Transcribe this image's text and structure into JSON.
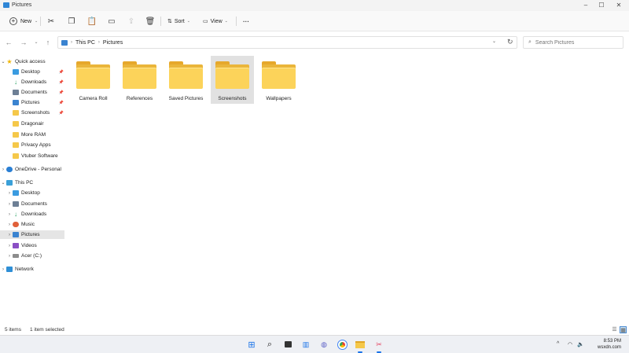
{
  "window": {
    "title": "Pictures",
    "controls": [
      "minimize-icon",
      "maximize-icon",
      "close-icon"
    ]
  },
  "toolbar": {
    "new_label": "New",
    "sort_label": "Sort",
    "view_label": "View",
    "more_label": "···",
    "icons": [
      "cut-icon",
      "copy-icon",
      "paste-icon",
      "rename-icon",
      "share-icon",
      "delete-icon"
    ]
  },
  "address": {
    "crumbs": [
      "This PC",
      "Pictures"
    ],
    "search_placeholder": "Search Pictures"
  },
  "sidebar": {
    "quick_access": {
      "label": "Quick access",
      "items": [
        {
          "label": "Desktop",
          "icon": "desktop-icon",
          "pinned": true
        },
        {
          "label": "Downloads",
          "icon": "downloads-icon",
          "pinned": true
        },
        {
          "label": "Documents",
          "icon": "documents-icon",
          "pinned": true
        },
        {
          "label": "Pictures",
          "icon": "pictures-icon",
          "pinned": true
        },
        {
          "label": "Screenshots",
          "icon": "folder-icon",
          "pinned": true
        },
        {
          "label": "Dragonair",
          "icon": "folder-icon",
          "pinned": false
        },
        {
          "label": "More RAM",
          "icon": "folder-icon",
          "pinned": false
        },
        {
          "label": "Privacy Apps",
          "icon": "folder-icon",
          "pinned": false
        },
        {
          "label": "Vtuber Software",
          "icon": "folder-icon",
          "pinned": false
        }
      ]
    },
    "onedrive": {
      "label": "OneDrive - Personal"
    },
    "this_pc": {
      "label": "This PC",
      "items": [
        {
          "label": "Desktop",
          "icon": "desktop-icon"
        },
        {
          "label": "Documents",
          "icon": "documents-icon"
        },
        {
          "label": "Downloads",
          "icon": "downloads-icon"
        },
        {
          "label": "Music",
          "icon": "music-icon"
        },
        {
          "label": "Pictures",
          "icon": "pictures-icon",
          "selected": true
        },
        {
          "label": "Videos",
          "icon": "videos-icon"
        },
        {
          "label": "Acer (C:)",
          "icon": "drive-icon"
        }
      ]
    },
    "network": {
      "label": "Network"
    }
  },
  "folders": [
    {
      "name": "Camera Roll",
      "selected": false
    },
    {
      "name": "References",
      "selected": false
    },
    {
      "name": "Saved Pictures",
      "selected": false
    },
    {
      "name": "Screenshots",
      "selected": true
    },
    {
      "name": "Wallpapers",
      "selected": false
    }
  ],
  "status": {
    "item_count": "5 items",
    "selection": "1 item selected"
  },
  "taskbar": {
    "icons": [
      "start-icon",
      "search-icon",
      "task-view-icon",
      "widgets-icon",
      "chat-icon",
      "chrome-icon",
      "file-explorer-icon",
      "snipping-tool-icon"
    ],
    "time": "8:53 PM",
    "date": "wsxdn.com"
  },
  "colors": {
    "folder": "#fcd35a",
    "selection": "#e1e1e1",
    "accent": "#1a73e8"
  }
}
